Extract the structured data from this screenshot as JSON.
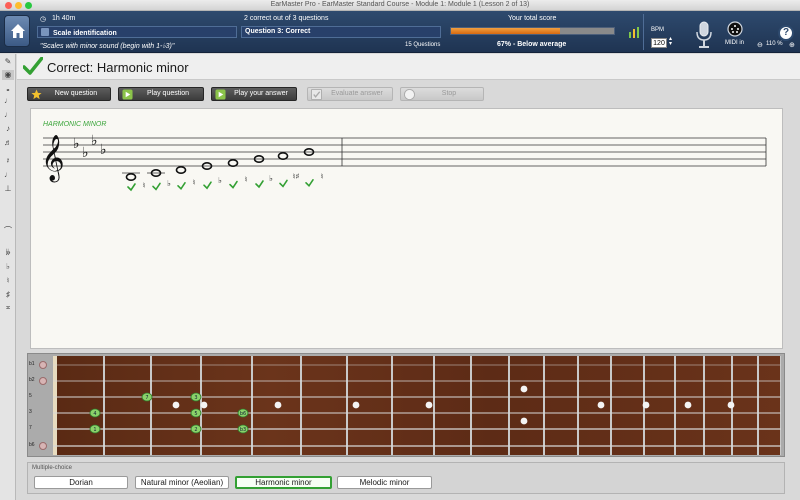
{
  "window": {
    "title": "EarMaster Pro - EarMaster Standard Course - Module 1: Module 1 (Lesson 2 of 13)"
  },
  "header": {
    "time": "1h 40m",
    "exercise": "Scale identification",
    "description": "\"Scales with minor sound (begin with 1-♭3)\"",
    "progress_text": "2 correct out of 3 questions",
    "question_status": "Question 3: Correct",
    "question_count": "15 Questions",
    "score_title": "Your total score",
    "score_text": "67% - Below average",
    "score_fraction": 0.67,
    "bpm_label": "BPM",
    "bpm_value": "120",
    "midi_label": "MIDI in",
    "zoom": "110 %",
    "help": "?"
  },
  "result": {
    "text": "Correct: Harmonic minor"
  },
  "actions": {
    "new_question": "New question",
    "play_question": "Play question",
    "play_answer": "Play your answer",
    "evaluate": "Evaluate answer",
    "stop": "Stop"
  },
  "staff": {
    "title": "HARMONIC MINOR",
    "accidental_labels": [
      "♮",
      "♭",
      "♮",
      "♭",
      "♮",
      "♭",
      "♮♯",
      "♮",
      "♭"
    ]
  },
  "fretboard": {
    "strings": [
      "b1",
      "b2",
      "5",
      "3",
      "7",
      "b6"
    ],
    "markers": [
      "7",
      "3",
      "4",
      "5",
      "b6",
      "1",
      "2",
      "b3"
    ]
  },
  "choices": {
    "label": "Multiple-choice",
    "items": [
      "Dorian",
      "Natural minor (Aeolian)",
      "Harmonic minor",
      "Melodic minor"
    ],
    "selected": "Harmonic minor"
  },
  "colors": {
    "correct": "#33a033",
    "header": "#2e4a6e",
    "score_fill": "#e07a1a"
  }
}
